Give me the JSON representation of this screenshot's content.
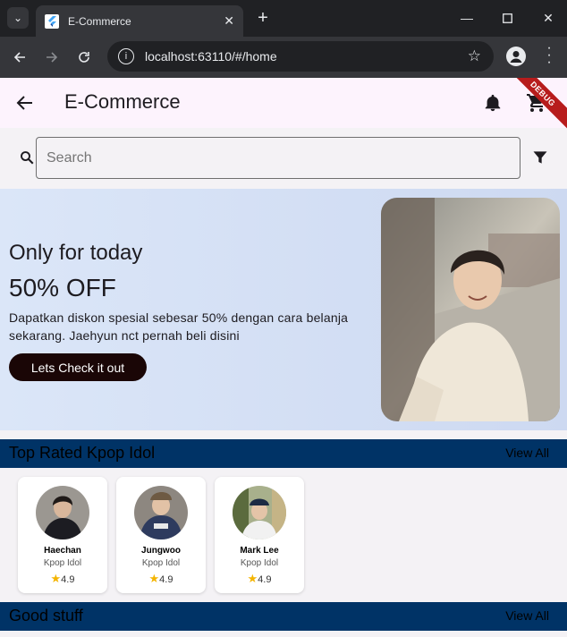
{
  "browser": {
    "tab_title": "E-Commerce",
    "url": "localhost:63110/#/home"
  },
  "appbar": {
    "title": "E-Commerce",
    "debug_label": "DEBUG"
  },
  "search": {
    "placeholder": "Search"
  },
  "banner": {
    "eyebrow": "Only for today",
    "headline": "50% OFF",
    "description": "Dapatkan diskon spesial sebesar 50% dengan cara belanja sekarang. Jaehyun nct pernah beli disini",
    "cta_label": "Lets Check it out"
  },
  "sections": {
    "top_rated": {
      "title": "Top Rated Kpop Idol",
      "view_all": "View All"
    },
    "good_stuff": {
      "title": "Good stuff",
      "view_all": "View All"
    }
  },
  "idols": [
    {
      "name": "Haechan",
      "role": "Kpop Idol",
      "rating": "4.9"
    },
    {
      "name": "Jungwoo",
      "role": "Kpop Idol",
      "rating": "4.9"
    },
    {
      "name": "Mark Lee",
      "role": "Kpop Idol",
      "rating": "4.9"
    }
  ],
  "colors": {
    "section_bar": "#003366",
    "appbar_bg": "#fdf3fd",
    "cta_bg": "#1a0606",
    "debug_banner": "#b71c1c"
  }
}
